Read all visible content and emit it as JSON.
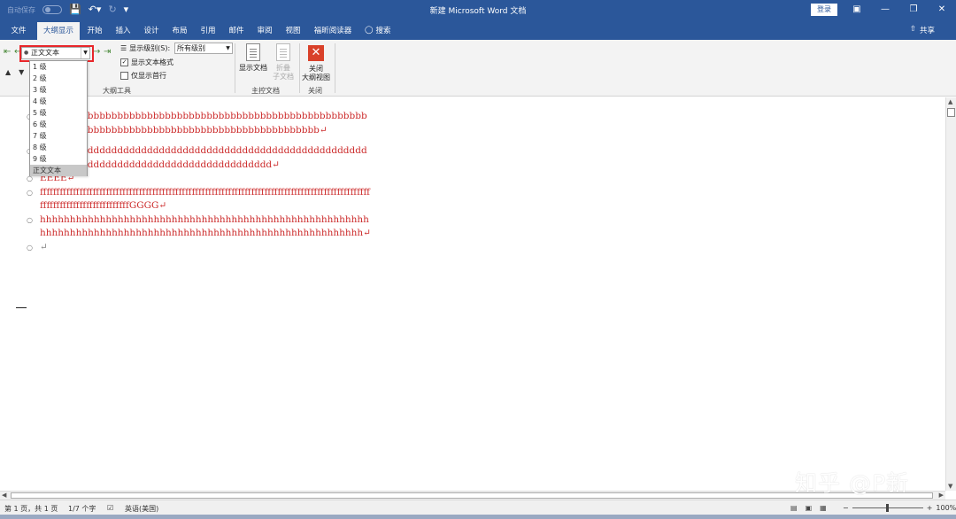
{
  "titlebar": {
    "autosave": "自动保存",
    "save_icon": "save-icon",
    "undo_icon": "undo-icon",
    "redo_icon": "redo-icon",
    "customize_icon": "customize-qat-icon",
    "title": "新建 Microsoft Word 文档",
    "login": "登录"
  },
  "tabs": {
    "file": "文件",
    "outline": "大纲显示",
    "home": "开始",
    "insert": "插入",
    "design": "设计",
    "layout": "布局",
    "references": "引用",
    "mailings": "邮件",
    "review": "审阅",
    "view": "视图",
    "reader": "福昕阅读器",
    "search": "搜索",
    "share": "共享"
  },
  "ribbon": {
    "level_value": "正文文本",
    "show_level_label": "显示级别(S):",
    "show_level_value": "所有级别",
    "show_text_format": "显示文本格式",
    "show_first_line": "仅显示首行",
    "outline_tools": "大纲工具",
    "show_document": "显示文档",
    "collapse_subdoc_1": "折叠",
    "collapse_subdoc_2": "子文档",
    "master_document": "主控文档",
    "close_view_1": "关闭",
    "close_view_2": "大纲视图",
    "close_group": "关闭"
  },
  "dropdown": {
    "items": [
      "1 级",
      "2 级",
      "3 级",
      "4 级",
      "5 级",
      "6 级",
      "7 级",
      "8 级",
      "9 级",
      "正文文本"
    ],
    "selected_index": 9
  },
  "document": {
    "items": [
      "bbbbbbbbbbbbbbbbbbbbbbbbbbbbbbbbbbbbbbbbbbbbbbbbbbbbbbbbbbbbbbbbbbbbbbbbbbbbbbbbbbbbbbbbbbbbbbbbbbbbbb↵",
      "dddddddddddddddddddddddddddddddddddddddddddddddddddddddddddddddddddddddddddddddddddddddddddddd↵",
      "EEEE↵",
      "fffffffffffffffffffffffffffffffffffffffffffffffffffffffffffffffffffffffffffffffffffffffffffffffffffffffffffffffffffffffffffffffGGGG↵",
      "hhhhhhhhhhhhhhhhhhhhhhhhhhhhhhhhhhhhhhhhhhhhhhhhhhhhhhhhhhhhhhhhhhhhhhhhhhhhhhhhhhhhhhhhhhhhhhhhhhhhhhhhhhhhh↵",
      "↵"
    ]
  },
  "statusbar": {
    "page": "第 1 页，共 1 页",
    "words": "1/7 个字",
    "language": "英语(美国)",
    "zoom": "100%"
  },
  "watermark": "知乎 @P新",
  "colors": {
    "brand": "#2b579a",
    "text_red": "#cc2a2a",
    "highlight_box": "#e8262a"
  }
}
